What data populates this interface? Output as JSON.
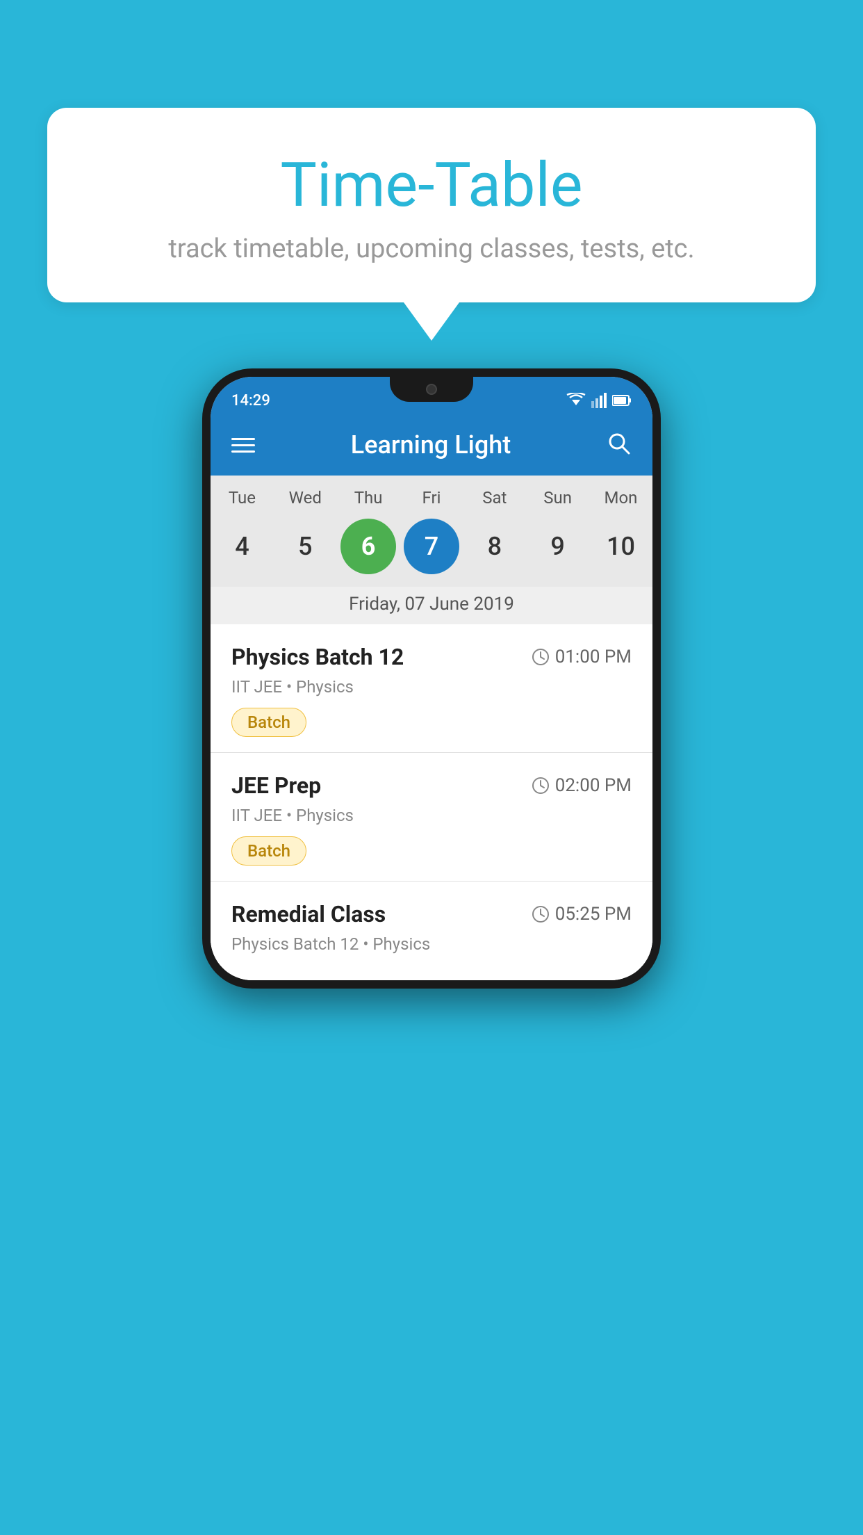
{
  "background_color": "#29b6d8",
  "speech_bubble": {
    "title": "Time-Table",
    "subtitle": "track timetable, upcoming classes, tests, etc."
  },
  "phone": {
    "status_bar": {
      "time": "14:29"
    },
    "app_bar": {
      "title": "Learning Light",
      "menu_icon": "menu-icon",
      "search_icon": "search-icon"
    },
    "calendar": {
      "days": [
        "Tue",
        "Wed",
        "Thu",
        "Fri",
        "Sat",
        "Sun",
        "Mon"
      ],
      "dates": [
        "4",
        "5",
        "6",
        "7",
        "8",
        "9",
        "10"
      ],
      "today_index": 2,
      "selected_index": 3,
      "selected_label": "Friday, 07 June 2019"
    },
    "classes": [
      {
        "name": "Physics Batch 12",
        "time": "01:00 PM",
        "subtitle": "IIT JEE • Physics",
        "tag": "Batch"
      },
      {
        "name": "JEE Prep",
        "time": "02:00 PM",
        "subtitle": "IIT JEE • Physics",
        "tag": "Batch"
      },
      {
        "name": "Remedial Class",
        "time": "05:25 PM",
        "subtitle": "Physics Batch 12 • Physics",
        "tag": ""
      }
    ]
  }
}
